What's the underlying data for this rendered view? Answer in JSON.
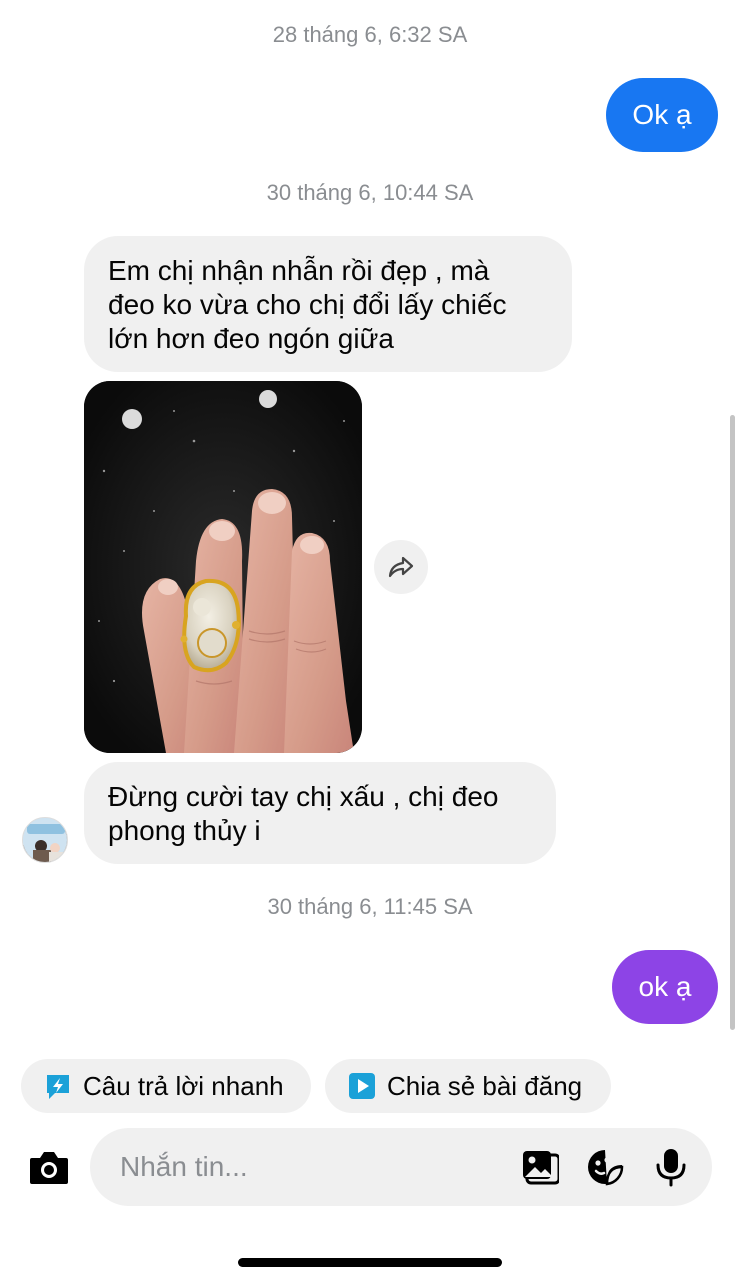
{
  "messages": {
    "ts1": "28 tháng 6, 6:32 SA",
    "out1": "Ok ạ",
    "ts2": "30 tháng 6, 10:44 SA",
    "in1_lines": [
      "Em chị nhận nhẫn rồi đẹp , mà",
      "đeo ko vừa cho chị đổi lấy chiếc",
      "lớn hơn đeo ngón giữa"
    ],
    "in2_lines": [
      "Đừng cười tay chị xấu , chị đeo",
      "phong thủy i"
    ],
    "ts3": "30 tháng 6, 11:45 SA",
    "out2": "ok ạ"
  },
  "colors": {
    "out1_bubble": "#1877f2",
    "out2_bubble": "#8d44e6",
    "incoming_bubble": "#f0f0f0",
    "timestamp": "#8a8d91",
    "chip_icon": "#1ba1d8"
  },
  "quick_actions": {
    "quick_reply": "Câu trả lời nhanh",
    "share_post": "Chia sẻ bài đăng"
  },
  "composer": {
    "placeholder": "Nhắn tin..."
  }
}
